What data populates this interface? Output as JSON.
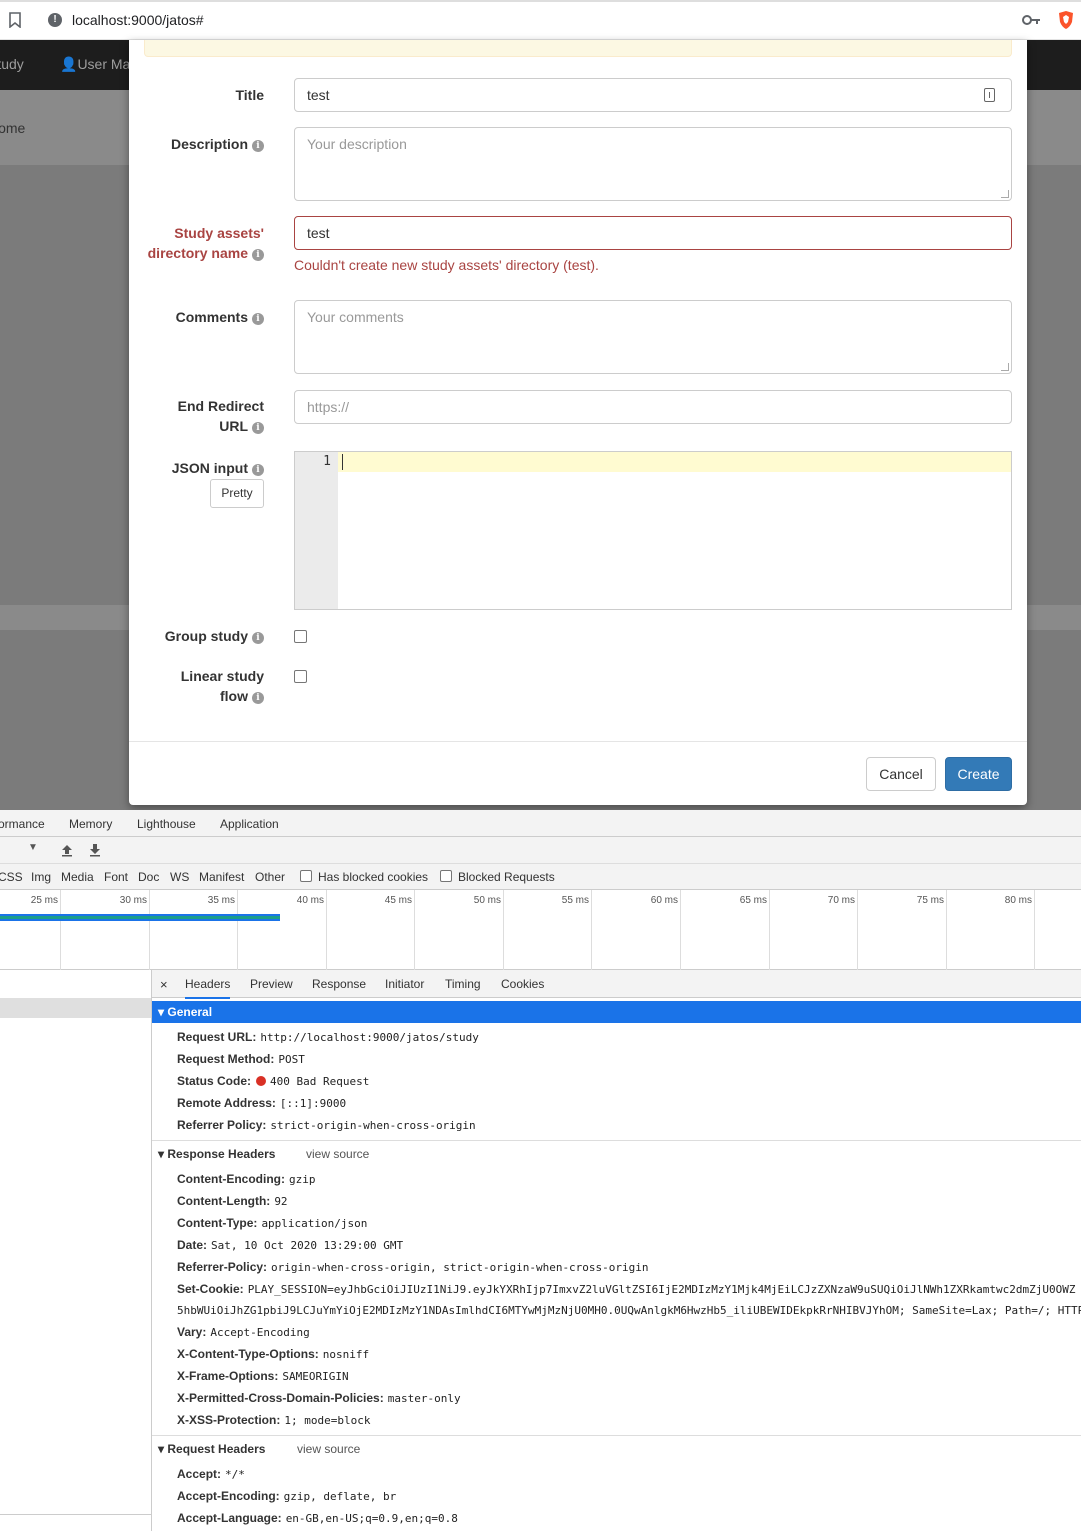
{
  "browser": {
    "url": "localhost:9000/jatos#"
  },
  "app": {
    "nav_study": "Study",
    "nav_user": "User Ma",
    "breadcrumb": "Home"
  },
  "form": {
    "title_label": "Title",
    "title_value": "test",
    "description_label": "Description",
    "description_placeholder": "Your description",
    "assets_label_line1": "Study assets'",
    "assets_label_line2": "directory name",
    "assets_value": "test",
    "assets_error": "Couldn't create new study assets' directory (test).",
    "comments_label": "Comments",
    "comments_placeholder": "Your comments",
    "redirect_label_line1": "End Redirect",
    "redirect_label_line2": "URL",
    "redirect_placeholder": "https://",
    "json_label": "JSON input",
    "json_line_number": "1",
    "pretty_button": "Pretty",
    "group_label": "Group study",
    "linear_label_line1": "Linear study",
    "linear_label_line2": "flow",
    "cancel_button": "Cancel",
    "create_button": "Create"
  },
  "devtools": {
    "tabs": [
      "ormance",
      "Memory",
      "Lighthouse",
      "Application"
    ],
    "filters": [
      "CSS",
      "Img",
      "Media",
      "Font",
      "Doc",
      "WS",
      "Manifest",
      "Other"
    ],
    "has_blocked_cookies": "Has blocked cookies",
    "blocked_requests": "Blocked Requests",
    "timeline_ticks": [
      "25 ms",
      "30 ms",
      "35 ms",
      "40 ms",
      "45 ms",
      "50 ms",
      "55 ms",
      "60 ms",
      "65 ms",
      "70 ms",
      "75 ms",
      "80 ms"
    ],
    "close": "×",
    "subtabs": [
      "Headers",
      "Preview",
      "Response",
      "Initiator",
      "Timing",
      "Cookies"
    ],
    "general_title": "General",
    "general": [
      {
        "k": "Request URL:",
        "v": "http://localhost:9000/jatos/study"
      },
      {
        "k": "Request Method:",
        "v": "POST"
      },
      {
        "k": "Status Code:",
        "v": "400 Bad Request"
      },
      {
        "k": "Remote Address:",
        "v": "[::1]:9000"
      },
      {
        "k": "Referrer Policy:",
        "v": "strict-origin-when-cross-origin"
      }
    ],
    "response_headers_title": "Response Headers",
    "view_source": "view source",
    "response_headers": [
      {
        "k": "Content-Encoding:",
        "v": "gzip"
      },
      {
        "k": "Content-Length:",
        "v": "92"
      },
      {
        "k": "Content-Type:",
        "v": "application/json"
      },
      {
        "k": "Date:",
        "v": "Sat, 10 Oct 2020 13:29:00 GMT"
      },
      {
        "k": "Referrer-Policy:",
        "v": "origin-when-cross-origin, strict-origin-when-cross-origin"
      },
      {
        "k": "Set-Cookie:",
        "v": "PLAY_SESSION=eyJhbGciOiJIUzI1NiJ9.eyJkYXRhIjp7ImxvZ2luVGltZSI6IjE2MDIzMzY1Mjk4MjEiLCJzZXNzaW9uSUQiOiJlNWh1ZXRkamtwc2dmZjU0OWZ"
      },
      {
        "k": "",
        "v": "5hbWUiOiJhZG1pbiJ9LCJuYmYiOjE2MDIzMzY1NDAsImlhdCI6MTYwMjMzNjU0MH0.0UQwAnlgkM6HwzHb5_iliUBEWIDEkpkRrNHIBVJYhOM; SameSite=Lax; Path=/; HTTP"
      },
      {
        "k": "Vary:",
        "v": "Accept-Encoding"
      },
      {
        "k": "X-Content-Type-Options:",
        "v": "nosniff"
      },
      {
        "k": "X-Frame-Options:",
        "v": "SAMEORIGIN"
      },
      {
        "k": "X-Permitted-Cross-Domain-Policies:",
        "v": "master-only"
      },
      {
        "k": "X-XSS-Protection:",
        "v": "1; mode=block"
      }
    ],
    "request_headers_title": "Request Headers",
    "request_headers": [
      {
        "k": "Accept:",
        "v": "*/*"
      },
      {
        "k": "Accept-Encoding:",
        "v": "gzip, deflate, br"
      },
      {
        "k": "Accept-Language:",
        "v": "en-GB,en-US;q=0.9,en;q=0.8"
      }
    ],
    "status_dot_color": "#d93025",
    "accent_color": "#1a73e8"
  }
}
